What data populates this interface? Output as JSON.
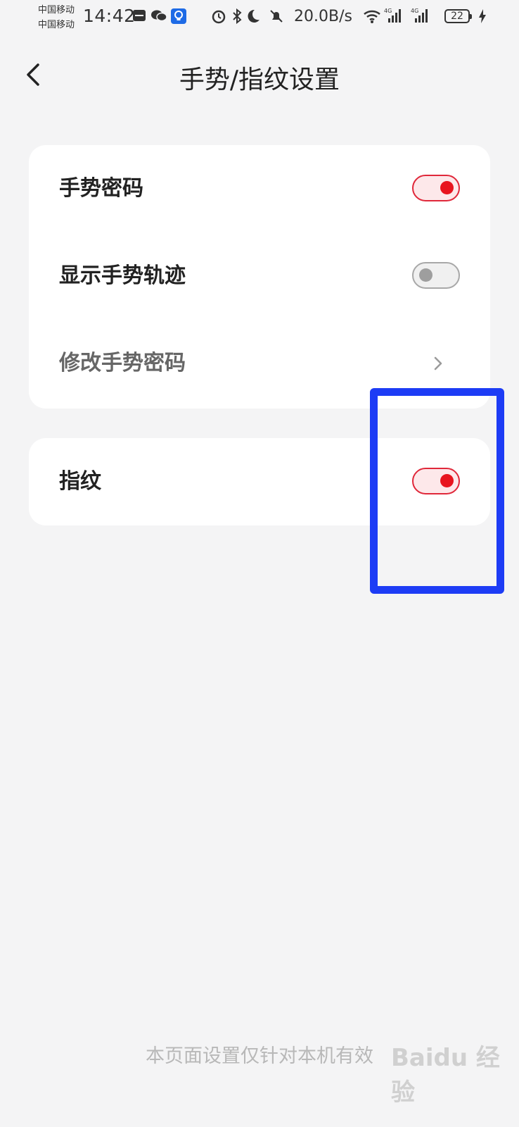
{
  "status_bar": {
    "carrier_1": "中国移动",
    "carrier_2": "中国移动",
    "time": "14:42",
    "net_speed": "20.0B/s",
    "network_1": "4G",
    "network_2": "4G",
    "battery_level": "22",
    "icons": [
      "huawei-app-icon",
      "wechat-icon",
      "bulb-app-icon",
      "alarm-icon",
      "bluetooth-icon",
      "moon-icon",
      "mute-bell-icon",
      "wifi-icon",
      "signal-icon",
      "signal-icon",
      "battery-icon",
      "charging-icon"
    ]
  },
  "header": {
    "title": "手势/指纹设置",
    "back_icon": "chevron-left-icon"
  },
  "settings": {
    "gesture_password": {
      "label": "手势密码",
      "enabled": true
    },
    "show_gesture_trace": {
      "label": "显示手势轨迹",
      "enabled": false
    },
    "change_gesture_password": {
      "label": "修改手势密码",
      "icon": "chevron-right-icon"
    },
    "fingerprint": {
      "label": "指纹",
      "enabled": true
    }
  },
  "footer": {
    "note": "本页面设置仅针对本机有效",
    "watermark": "Baidu 经验"
  },
  "colors": {
    "toggle_on": "#e8151f",
    "toggle_off": "#9e9e9e",
    "highlight": "#1d3cf5",
    "background": "#f4f4f5"
  }
}
